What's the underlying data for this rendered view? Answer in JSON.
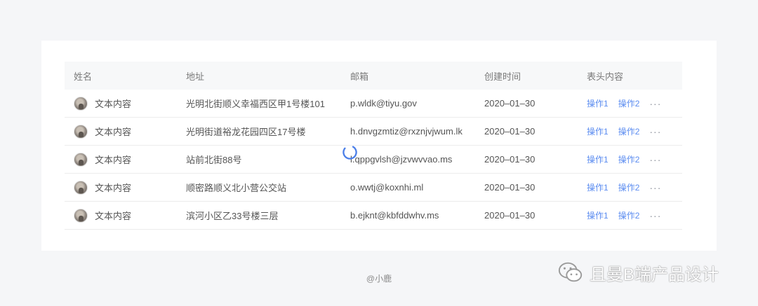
{
  "table": {
    "headers": [
      "姓名",
      "地址",
      "邮箱",
      "创建时间",
      "表头内容"
    ],
    "rows": [
      {
        "name": "文本内容",
        "address": "光明北街顺义幸福西区甲1号楼101",
        "email": "p.wldk@tiyu.gov",
        "date": "2020–01–30",
        "op1": "操作1",
        "op2": "操作2",
        "more": "···"
      },
      {
        "name": "文本内容",
        "address": "光明街道裕龙花园四区17号楼",
        "email": "h.dnvgzmtiz@rxznjvjwum.lk",
        "date": "2020–01–30",
        "op1": "操作1",
        "op2": "操作2",
        "more": "···"
      },
      {
        "name": "文本内容",
        "address": "站前北街88号",
        "email": "l.qppgvlsh@jzvwvvao.ms",
        "date": "2020–01–30",
        "op1": "操作1",
        "op2": "操作2",
        "more": "···"
      },
      {
        "name": "文本内容",
        "address": "顺密路顺义北小营公交站",
        "email": "o.wwtj@koxnhi.ml",
        "date": "2020–01–30",
        "op1": "操作1",
        "op2": "操作2",
        "more": "···"
      },
      {
        "name": "文本内容",
        "address": "滨河小区乙33号楼三层",
        "email": "b.ejknt@kbfddwhv.ms",
        "date": "2020–01–30",
        "op1": "操作1",
        "op2": "操作2",
        "more": "···"
      }
    ]
  },
  "footer": {
    "credit": "@小鹿"
  },
  "watermark": {
    "text": "且曼B端产品设计",
    "icon": "wechat-icon"
  },
  "colors": {
    "link": "#5b8cf0",
    "spinner": "#4a7ee8",
    "header_bg": "#f7f8f9",
    "page_bg": "#f5f6f8"
  }
}
